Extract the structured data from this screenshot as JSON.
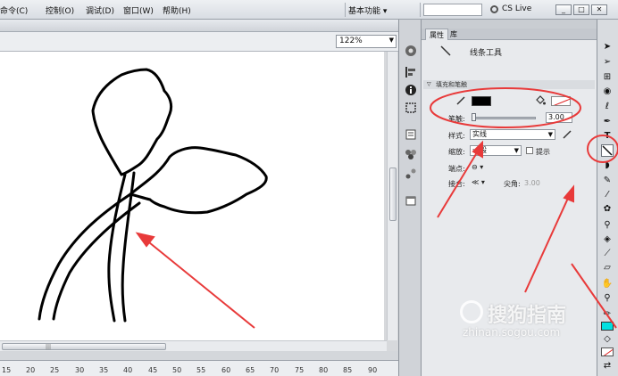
{
  "menubar": {
    "items": [
      "命令(C)",
      "控制(O)",
      "调试(D)",
      "窗口(W)",
      "帮助(H)"
    ],
    "workspace": "基本功能",
    "cs_live": "CS Live"
  },
  "editbar": {
    "zoom": "122%"
  },
  "ruler": {
    "ticks": [
      "15",
      "20",
      "25",
      "30",
      "35",
      "40",
      "45",
      "50",
      "55",
      "60",
      "65",
      "70",
      "75",
      "80",
      "85",
      "90"
    ]
  },
  "props": {
    "tabs": [
      "属性",
      "库"
    ],
    "tool_name": "线条工具",
    "section": "填充和笔触",
    "stroke_label": "笔触:",
    "stroke_value": "3.00",
    "style_label": "样式:",
    "style_value": "实线",
    "scale_label": "缩放:",
    "scale_value": "一般",
    "hint_label": "提示",
    "cap_label": "端点:",
    "join_label": "接合:",
    "miter_label": "尖角:",
    "miter_value": "3.00"
  },
  "watermark": {
    "text": "搜狗指南",
    "url": "zhinan.sogou.com"
  },
  "colors": {
    "annotation": "#e83a3a",
    "stroke": "#000000",
    "accent_fill": "#00e0e0"
  }
}
